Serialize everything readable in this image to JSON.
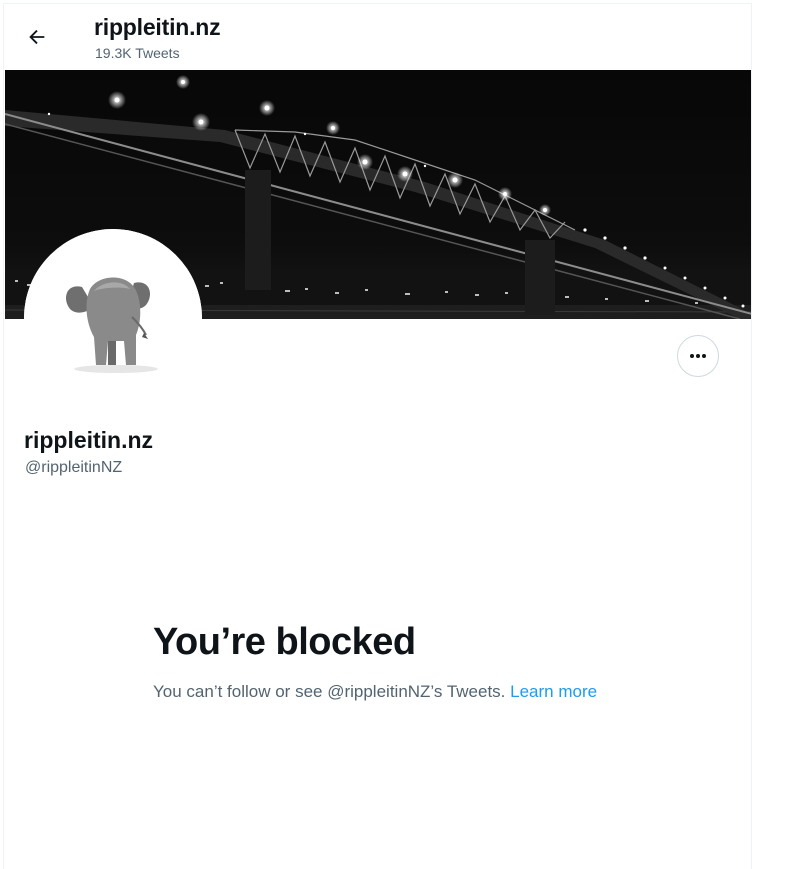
{
  "header": {
    "title": "rippleitin.nz",
    "tweet_count": "19.3K Tweets"
  },
  "profile": {
    "display_name": "rippleitin.nz",
    "handle": "@rippleitinNZ"
  },
  "blocked": {
    "title": "You’re blocked",
    "message": "You can’t follow or see @rippleitinNZ’s Tweets.",
    "link_label": "Learn more"
  },
  "colors": {
    "text_primary": "#0f1419",
    "text_secondary": "#536471",
    "link": "#1d9bf0",
    "border": "#cfd9de"
  },
  "icons": {
    "back": "arrow-left-icon",
    "more": "more-horizontal-icon"
  }
}
